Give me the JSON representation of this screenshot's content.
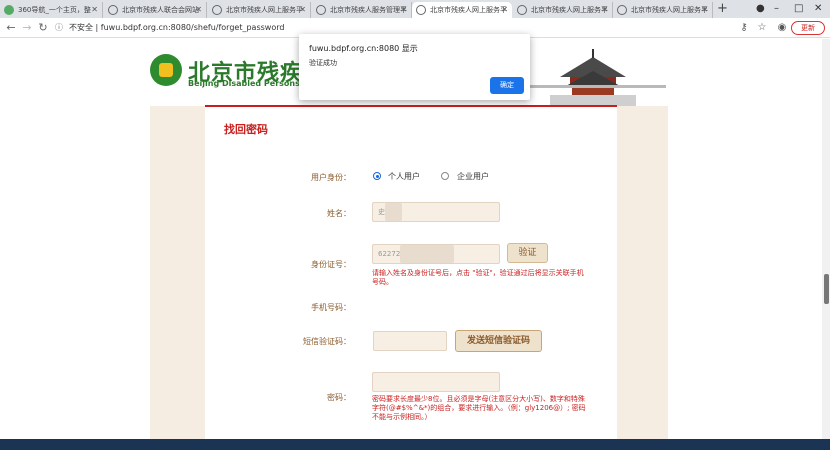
{
  "browser": {
    "tabs": [
      {
        "label": "360导航_一个主页，整"
      },
      {
        "label": "北京市残疾人联合会网站"
      },
      {
        "label": "北京市残疾人网上服务平"
      },
      {
        "label": "北京市残疾人服务管理平"
      },
      {
        "label": "北京市残疾人网上服务平"
      },
      {
        "label": "北京市残疾人网上服务平"
      },
      {
        "label": "北京市残疾人网上服务平"
      }
    ],
    "new_tab": "+",
    "address_security": "不安全",
    "url": "fuwu.bdpf.org.cn:8080/shefu/forget_password",
    "update_button": "更新"
  },
  "header": {
    "logo_cn": "北京市残疾人",
    "logo_en": "Beijing Disabled Persons' Fed"
  },
  "form": {
    "title": "找回密码",
    "identity_label": "用户身份：",
    "identity_options": [
      "个人用户",
      "企业用户"
    ],
    "name_label": "姓名：",
    "name_value": "史",
    "id_label": "身份证号：",
    "id_value": "62272",
    "verify_button": "验证",
    "verify_hint": "请输入姓名及身份证号后，点击 \"验证\"，验证通过后将显示关联手机号码。",
    "phone_label": "手机号码：",
    "sms_label": "短信验证码：",
    "sms_button": "发送短信验证码",
    "password_label": "密码：",
    "password_hint": "密码要求长度最少8位。且必须是字母(注意区分大小写)、数字和特殊字符(@#$%^&*)的组合，要求进行输入。（例：gly1206@）; 密码不能与示例相同。）"
  },
  "dialog": {
    "title": "fuwu.bdpf.org.cn:8080 显示",
    "message": "验证成功",
    "ok": "确定"
  },
  "colors": {
    "accent_red": "#c81e1e",
    "brand_green": "#2b7a2b",
    "panel_beige": "#f5ede1",
    "dialog_blue": "#1a73e8"
  }
}
